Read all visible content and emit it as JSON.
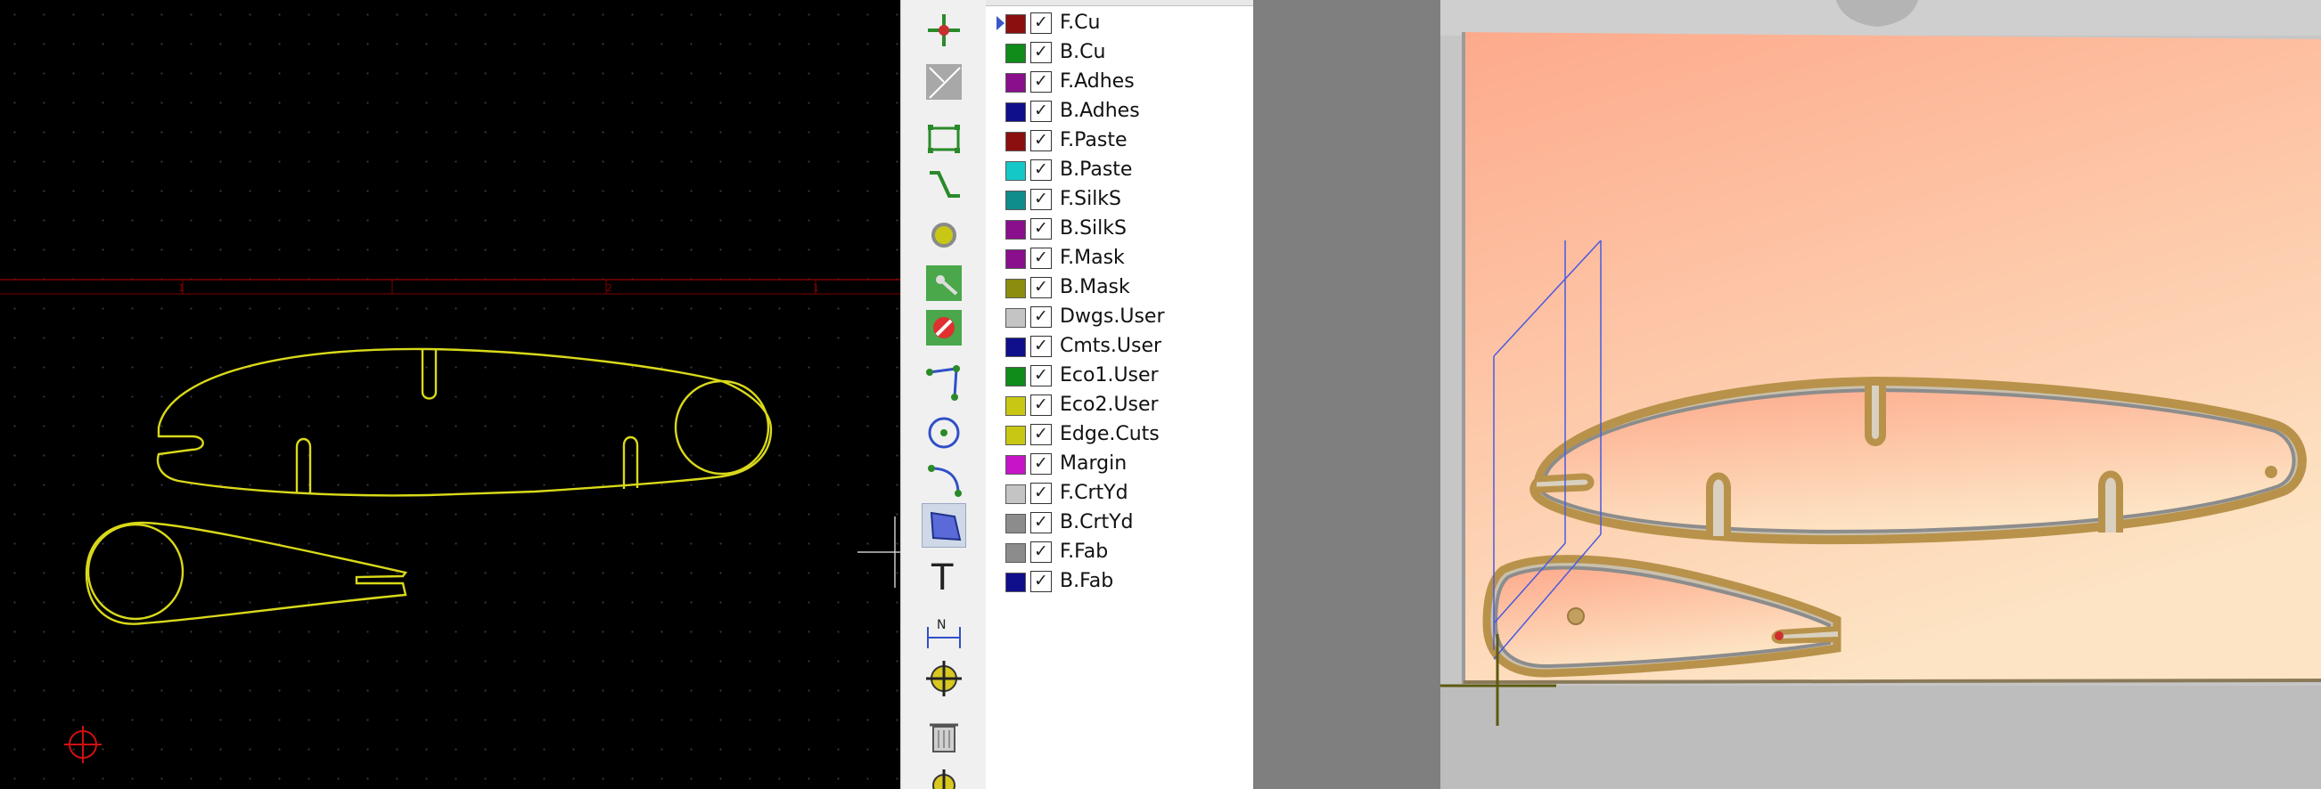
{
  "pcb_editor": {
    "ruler_ticks": [
      "1",
      "2",
      "1"
    ],
    "grid_visible": true,
    "outline_color": "#d9d91a",
    "origin_marker_color": "#d01010",
    "ruler_color": "#800000"
  },
  "toolbar": {
    "tools": [
      {
        "name": "highlight-net-icon",
        "active": false
      },
      {
        "name": "local-ratsnest-icon",
        "active": false
      },
      {
        "name": "add-footprint-icon",
        "active": false
      },
      {
        "name": "route-track-icon",
        "active": false
      },
      {
        "name": "add-via-icon",
        "active": false
      },
      {
        "name": "add-zone-icon",
        "active": false
      },
      {
        "name": "add-keepout-icon",
        "active": false
      },
      {
        "name": "draw-line-icon",
        "active": false
      },
      {
        "name": "draw-circle-icon",
        "active": false
      },
      {
        "name": "draw-arc-icon",
        "active": false
      },
      {
        "name": "draw-polygon-icon",
        "active": true
      },
      {
        "name": "add-text-icon",
        "active": false
      },
      {
        "name": "add-dimension-icon",
        "active": false
      },
      {
        "name": "place-anchor-icon",
        "active": false
      },
      {
        "name": "delete-tool-icon",
        "active": false
      },
      {
        "name": "grid-origin-icon",
        "active": false
      }
    ]
  },
  "layers": {
    "selected": "F.Cu",
    "items": [
      {
        "label": "F.Cu",
        "color": "#8c0f0f",
        "checked": "✓"
      },
      {
        "label": "B.Cu",
        "color": "#0f8c1a",
        "checked": "✓"
      },
      {
        "label": "F.Adhes",
        "color": "#8a0f8c",
        "checked": "✓"
      },
      {
        "label": "B.Adhes",
        "color": "#0f0f8c",
        "checked": "✓"
      },
      {
        "label": "F.Paste",
        "color": "#8c0f0f",
        "checked": "✓"
      },
      {
        "label": "B.Paste",
        "color": "#14c8c8",
        "checked": "✓"
      },
      {
        "label": "F.SilkS",
        "color": "#0f8c8c",
        "checked": "✓"
      },
      {
        "label": "B.SilkS",
        "color": "#8a0f8c",
        "checked": "✓"
      },
      {
        "label": "F.Mask",
        "color": "#8a0f8c",
        "checked": "✓"
      },
      {
        "label": "B.Mask",
        "color": "#8c8c0f",
        "checked": "✓"
      },
      {
        "label": "Dwgs.User",
        "color": "#c4c4c4",
        "checked": "✓"
      },
      {
        "label": "Cmts.User",
        "color": "#0f0f8c",
        "checked": "✓"
      },
      {
        "label": "Eco1.User",
        "color": "#0f8c1a",
        "checked": "✓"
      },
      {
        "label": "Eco2.User",
        "color": "#c8c814",
        "checked": "✓"
      },
      {
        "label": "Edge.Cuts",
        "color": "#c8c814",
        "checked": "✓"
      },
      {
        "label": "Margin",
        "color": "#c814c8",
        "checked": "✓"
      },
      {
        "label": "F.CrtYd",
        "color": "#c4c4c4",
        "checked": "✓"
      },
      {
        "label": "B.CrtYd",
        "color": "#8c8c8c",
        "checked": "✓"
      },
      {
        "label": "F.Fab",
        "color": "#8c8c8c",
        "checked": "✓"
      },
      {
        "label": "B.Fab",
        "color": "#0f0f8c",
        "checked": "✓"
      }
    ]
  },
  "viewer3d": {
    "background_color": "#c6c6c6",
    "board_color_top": "#fdaa8c",
    "board_color_bottom": "#fde4c4",
    "copper_color": "#b8924a",
    "axis_color": "#5c5a10"
  }
}
